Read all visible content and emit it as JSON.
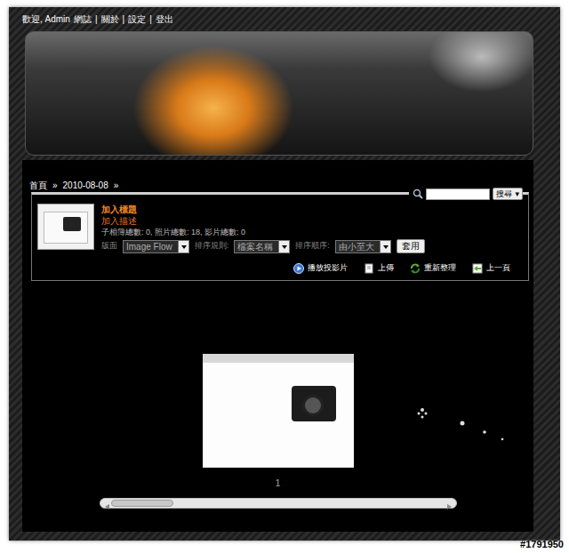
{
  "top_links": {
    "greeting": "歡迎, Admin",
    "items": [
      "網誌",
      "關於",
      "設定",
      "登出"
    ],
    "separator": "|"
  },
  "breadcrumb": {
    "items": [
      "首頁",
      "2010-08-08"
    ],
    "separator": "»"
  },
  "album": {
    "title": "加入標題",
    "description": "加入描述",
    "stats": "子相簿總數: 0, 照片總數: 18, 影片總數: 0",
    "controls": [
      {
        "label": "版面",
        "value": "Image Flow"
      },
      {
        "label": "排序規則:",
        "value": "檔案名稱"
      },
      {
        "label": "排序順序:",
        "value": "由小至大"
      }
    ],
    "apply_button": "套用"
  },
  "search": {
    "button": "搜尋",
    "button_arrow": "▾"
  },
  "actions": [
    {
      "label": "播放投影片",
      "kind": "play"
    },
    {
      "label": "上傳",
      "kind": "upload"
    },
    {
      "label": "重新整理",
      "kind": "refresh"
    },
    {
      "label": "上一頁",
      "kind": "back"
    }
  ],
  "viewer": {
    "caption": "1",
    "scroll": {
      "level": 0
    }
  },
  "watermark": "#1791950"
}
